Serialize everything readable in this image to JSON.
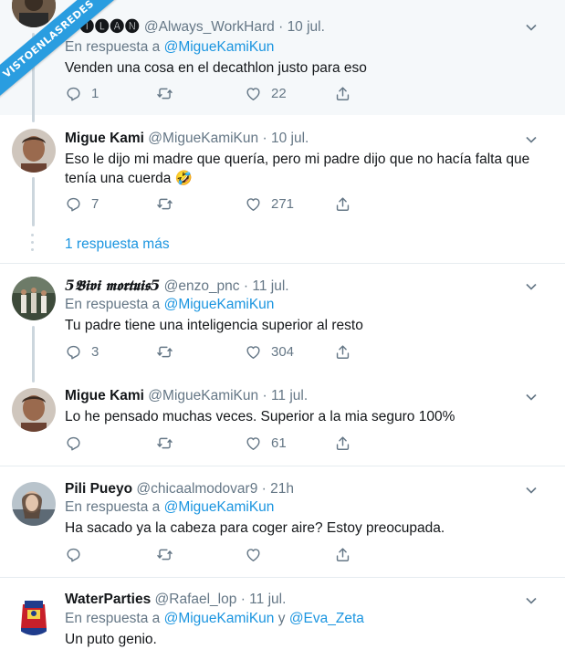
{
  "watermark": "VISTOENLASREDES",
  "more_replies": "1 respuesta más",
  "reply_prefix": "En respuesta a",
  "reply_and": "y",
  "tweets": [
    {
      "name": "🅓🅘🅛🅐🅝",
      "handle": "@Always_WorkHard",
      "date": "10 jul.",
      "reply_to": [
        "@MigueKamiKun"
      ],
      "text": "Venden una cosa en el decathlon justo para eso",
      "replies": "1",
      "retweets": "",
      "likes": "22"
    },
    {
      "name": "Migue Kami",
      "handle": "@MigueKamiKun",
      "date": "10 jul.",
      "text": "Eso le dijo mi madre que quería, pero mi padre dijo que no hacía falta que tenía una cuerda 🤣",
      "replies": "7",
      "retweets": "",
      "likes": "271"
    },
    {
      "name": "5𝕭𝖎𝖛𝖎 𝖒𝖔𝖗𝖙𝖚𝖎𝖘5",
      "handle": "@enzo_pnc",
      "date": "11 jul.",
      "reply_to": [
        "@MigueKamiKun"
      ],
      "text": "Tu padre tiene una inteligencia superior al resto",
      "replies": "3",
      "retweets": "",
      "likes": "304"
    },
    {
      "name": "Migue Kami",
      "handle": "@MigueKamiKun",
      "date": "11 jul.",
      "text": "Lo he pensado muchas veces. Superior a la mia seguro 100%",
      "replies": "",
      "retweets": "",
      "likes": "61"
    },
    {
      "name": "Pili Pueyo",
      "handle": "@chicaalmodovar9",
      "date": "21h",
      "reply_to": [
        "@MigueKamiKun"
      ],
      "text": "Ha sacado ya la cabeza para coger aire? Estoy preocupada.",
      "replies": "",
      "retweets": "",
      "likes": ""
    },
    {
      "name": "WaterParties",
      "handle": "@Rafael_lop",
      "date": "11 jul.",
      "reply_to": [
        "@MigueKamiKun",
        "@Eva_Zeta"
      ],
      "text": "Un puto genio.",
      "replies": "",
      "retweets": "",
      "likes": ""
    }
  ],
  "colors": {
    "accent": "#1b95e0",
    "muted": "#657786",
    "highlight_bg": "#f5f8fa",
    "watermark": "#2a9de0"
  },
  "icons": [
    "reply-icon",
    "retweet-icon",
    "like-icon",
    "share-icon",
    "chevron-down-icon"
  ]
}
